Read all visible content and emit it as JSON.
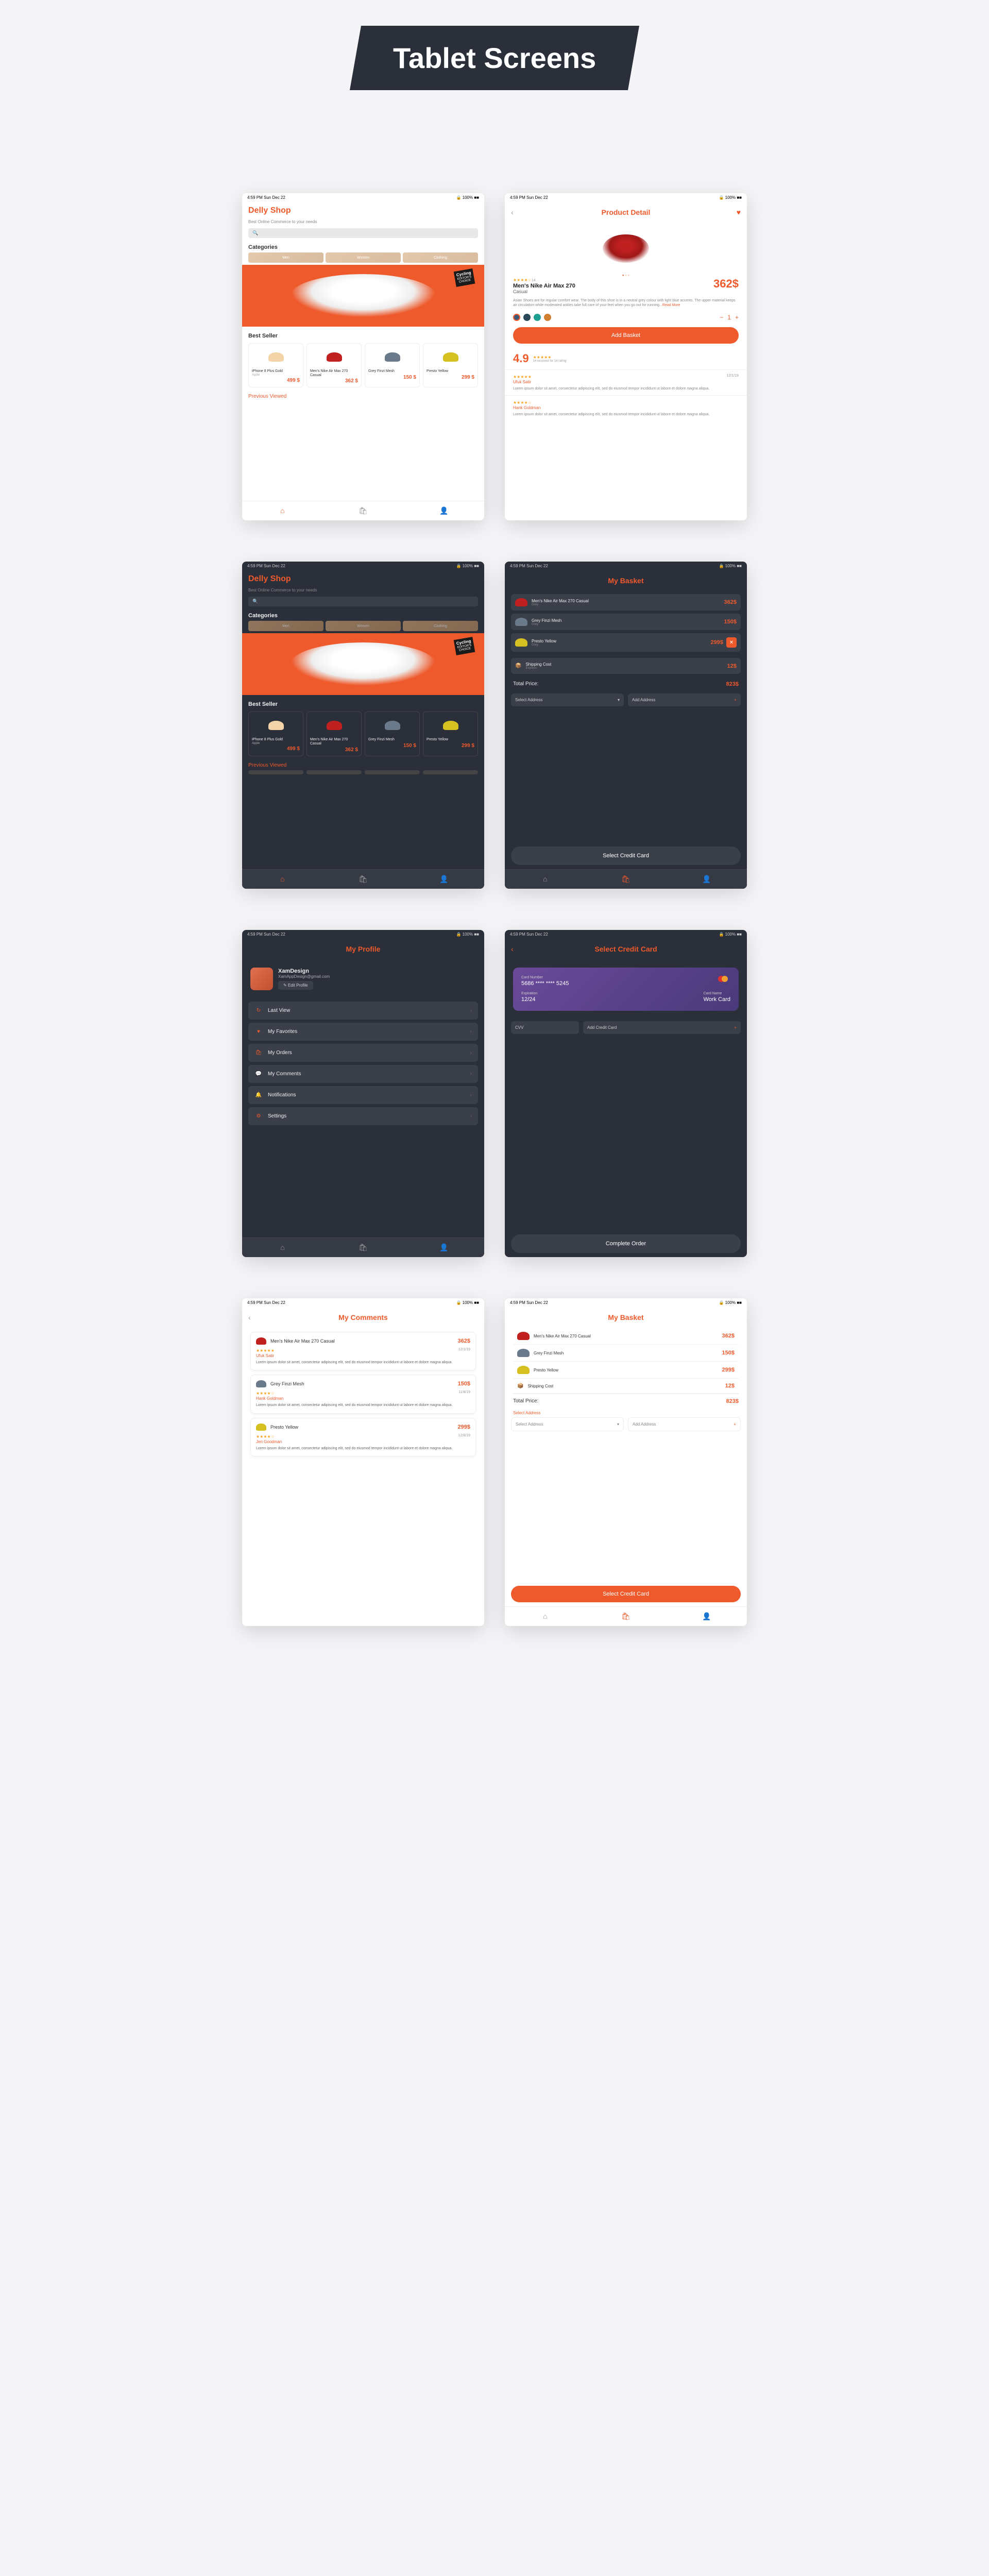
{
  "header": "Tablet Screens",
  "statusBar": {
    "time": "4:59 PM   Sun Dec 22",
    "signal": "🔒 100% ■■"
  },
  "shop": {
    "title": "Delly Shop",
    "subtitle": "Best Online Commerce to your needs",
    "searchPlaceholder": "🔍",
    "categoriesLabel": "Categories",
    "categories": [
      "Men",
      "Women",
      "Clothing"
    ],
    "heroBadge1": "EDITOR'S",
    "heroBadge2": "CHOICE",
    "heroBrand": "Cycling",
    "bestSellerLabel": "Best Seller",
    "prevViewedLabel": "Previous Viewed",
    "products": [
      {
        "name": "iPhone 8 Plus Gold",
        "sub": "Apple",
        "price": "499 $",
        "color": "#f2d4a8"
      },
      {
        "name": "Men's Nike Air Max 270 Casual",
        "sub": "",
        "price": "362 $",
        "color": "#c02020"
      },
      {
        "name": "Grey Finzi Mesh",
        "sub": "",
        "price": "150 $",
        "color": "#6a7a8a"
      },
      {
        "name": "Presto Yellow",
        "sub": "",
        "price": "299 $",
        "color": "#d4c020"
      }
    ]
  },
  "detail": {
    "title": "Product Detail",
    "name": "Men's Nike Air Max 270",
    "sub": "Casual",
    "price": "362$",
    "rating": "★★★★☆",
    "ratingCount": "14",
    "desc": "Asian Shoes are for regular comfort wear. The body of this shoe is in a neutral grey colour with light blue accents. The upper material keeps air circulation while moderated ankles take full care of your feet when you go out for running...",
    "readMore": "Read More",
    "swatches": [
      "#3a5a7a",
      "#2a4a5a",
      "#20a090",
      "#d08030"
    ],
    "qtyMinus": "−",
    "qty": "1",
    "qtyPlus": "+",
    "addBasket": "Add Basket",
    "ratingNum": "4.9",
    "ratingStars": "★★★★★",
    "ratingSub": "14 received for 14 rating",
    "reviews": [
      {
        "user": "Ufuk Satir",
        "date": "12/1/19",
        "stars": "★★★★★",
        "text": "Lorem ipsum dolor sit amet, consectetur adipiscing elit, sed do eiusmod tempor incididunt ut labore et dolore magna aliqua."
      },
      {
        "user": "Hank Goldman",
        "date": "",
        "stars": "★★★★☆",
        "text": "Lorem ipsum dolor sit amet, consectetur adipiscing elit, sed do eiusmod tempor incididunt ut labore et dolore magna aliqua."
      }
    ]
  },
  "basketDark": {
    "title": "My Basket",
    "items": [
      {
        "name": "Men's Nike Air Max 270 Casual",
        "sub": "Grey",
        "price": "362$",
        "color": "#c02020"
      },
      {
        "name": "Grey Finzi Mesh",
        "sub": "Grey",
        "price": "150$",
        "color": "#6a7a8a"
      },
      {
        "name": "Presto Yellow",
        "sub": "Grey",
        "price": "299$",
        "color": "#d4c020",
        "del": true
      }
    ],
    "shipping": {
      "label": "Shipping Cost",
      "sub": "Express",
      "price": "12$"
    },
    "totalLabel": "Total Price:",
    "totalPrice": "823$",
    "selectAddr": "Select Address",
    "addAddr": "Add Address",
    "selectCard": "Select Credit Card"
  },
  "basketLight": {
    "title": "My Basket",
    "items": [
      {
        "name": "Men's Nike Air Max 270 Casual",
        "price": "362$",
        "color": "#c02020"
      },
      {
        "name": "Grey Finzi Mesh",
        "price": "150$",
        "color": "#6a7a8a"
      },
      {
        "name": "Presto Yellow",
        "price": "299$",
        "color": "#d4c020"
      }
    ],
    "shipping": {
      "label": "Shipping Cost",
      "price": "12$"
    },
    "totalLabel": "Total Price:",
    "totalPrice": "823$",
    "selectAddrLabel": "Select Address",
    "selectAddr": "Select Address",
    "addAddr": "Add Address",
    "selectCard": "Select Credit Card"
  },
  "profile": {
    "title": "My Profile",
    "name": "XamDesign",
    "email": "XamAppDesign@gmail.com",
    "edit": "Edit Profile",
    "menu": [
      {
        "icon": "↻",
        "label": "Last View"
      },
      {
        "icon": "♥",
        "label": "My Favorites"
      },
      {
        "icon": "🛍",
        "label": "My Orders"
      },
      {
        "icon": "💬",
        "label": "My Comments"
      },
      {
        "icon": "🔔",
        "label": "Notifications"
      },
      {
        "icon": "⚙",
        "label": "Settings"
      }
    ]
  },
  "card": {
    "title": "Select Credit Card",
    "numLabel": "Card Number",
    "num": "5686 **** **** 5245",
    "expLabel": "Expiration",
    "exp": "12/24",
    "nameLabel": "Card Name",
    "name": "Work Card",
    "cvv": "CVV",
    "addCard": "Add Credit Card",
    "complete": "Complete Order"
  },
  "comments": {
    "title": "My Comments",
    "items": [
      {
        "name": "Men's Nike Air Max 270 Casual",
        "price": "362$",
        "color": "#c02020",
        "user": "Ufuk Satir",
        "date": "12/1/19",
        "stars": "★★★★★",
        "text": "Lorem ipsum dolor sit amet, consectetur adipiscing elit, sed do eiusmod tempor incididunt ut labore et dolore magna aliqua."
      },
      {
        "name": "Grey Finzi Mesh",
        "price": "150$",
        "color": "#6a7a8a",
        "user": "Hank Goldman",
        "date": "11/8/19",
        "stars": "★★★★☆",
        "text": "Lorem ipsum dolor sit amet, consectetur adipiscing elit, sed do eiusmod tempor incididunt ut labore et dolore magna aliqua."
      },
      {
        "name": "Presto Yellow",
        "price": "299$",
        "color": "#d4c020",
        "user": "Jen Goodman",
        "date": "12/8/19",
        "stars": "★★★★☆",
        "text": "Lorem ipsum dolor sit amet, consectetur adipiscing elit, sed do eiusmod tempor incididunt ut labore et dolore magna aliqua."
      }
    ]
  },
  "tabs": {
    "home": "⌂",
    "bag": "🛍",
    "user": "👤"
  }
}
